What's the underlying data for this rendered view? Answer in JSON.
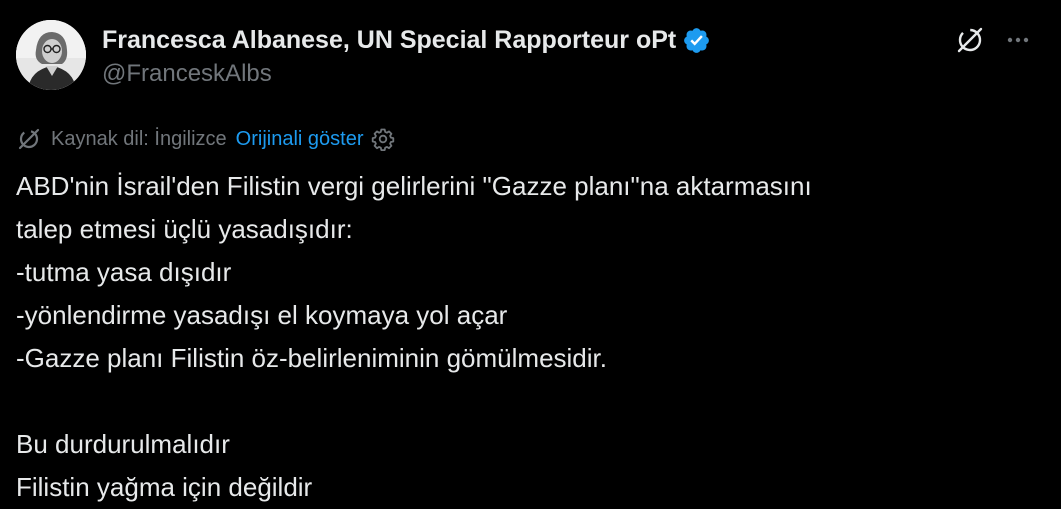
{
  "author": {
    "display_name": "Francesca Albanese, UN Special Rapporteur oPt",
    "handle": "@FranceskAlbs",
    "verified": true,
    "avatar_icon": "avatar-photo"
  },
  "actions": {
    "grok_icon": "grok-icon",
    "more_icon": "more-dots-icon"
  },
  "translation": {
    "source_language_label": "Kaynak dil: İngilizce",
    "show_original_label": "Orijinali göster",
    "translate_icon": "translate-icon",
    "settings_icon": "gear-icon"
  },
  "tweet": {
    "lines": [
      "ABD'nin İsrail'den Filistin vergi gelirlerini \"Gazze planı\"na aktarmasını",
      "talep etmesi üçlü yasadışıdır:",
      "-tutma yasa dışıdır",
      "-yönlendirme yasadışı el koymaya yol açar",
      "-Gazze planı Filistin öz-belirleniminin gömülmesidir.",
      "",
      "Bu durdurulmalıdır",
      "Filistin yağma için değildir"
    ]
  },
  "colors": {
    "background": "#000000",
    "text": "#e7e9ea",
    "secondary": "#71767b",
    "accent": "#1d9bf0"
  }
}
